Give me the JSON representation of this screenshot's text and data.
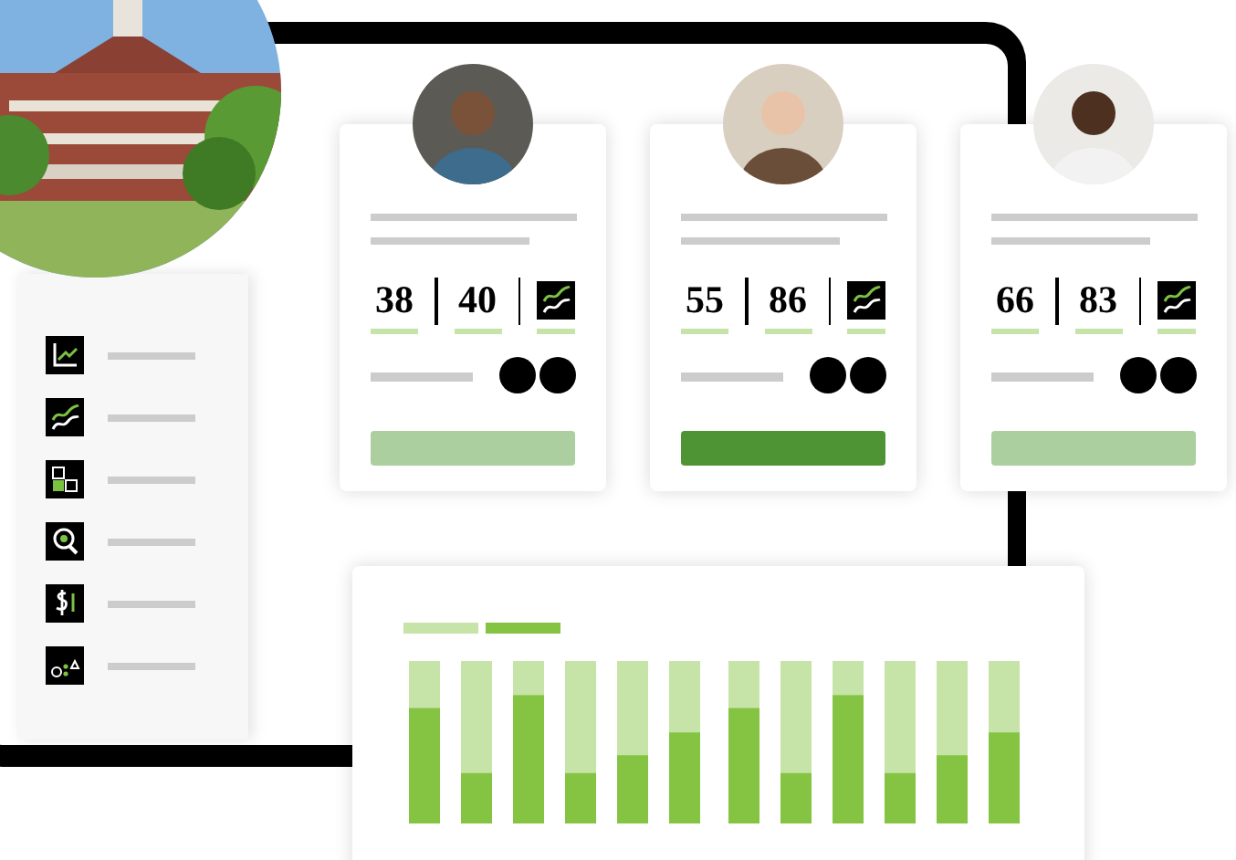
{
  "cards": [
    {
      "score_1": "38",
      "score_2": "40",
      "selected": false
    },
    {
      "score_1": "55",
      "score_2": "86",
      "selected": true
    },
    {
      "score_1": "66",
      "score_2": "83",
      "selected": false
    }
  ]
}
